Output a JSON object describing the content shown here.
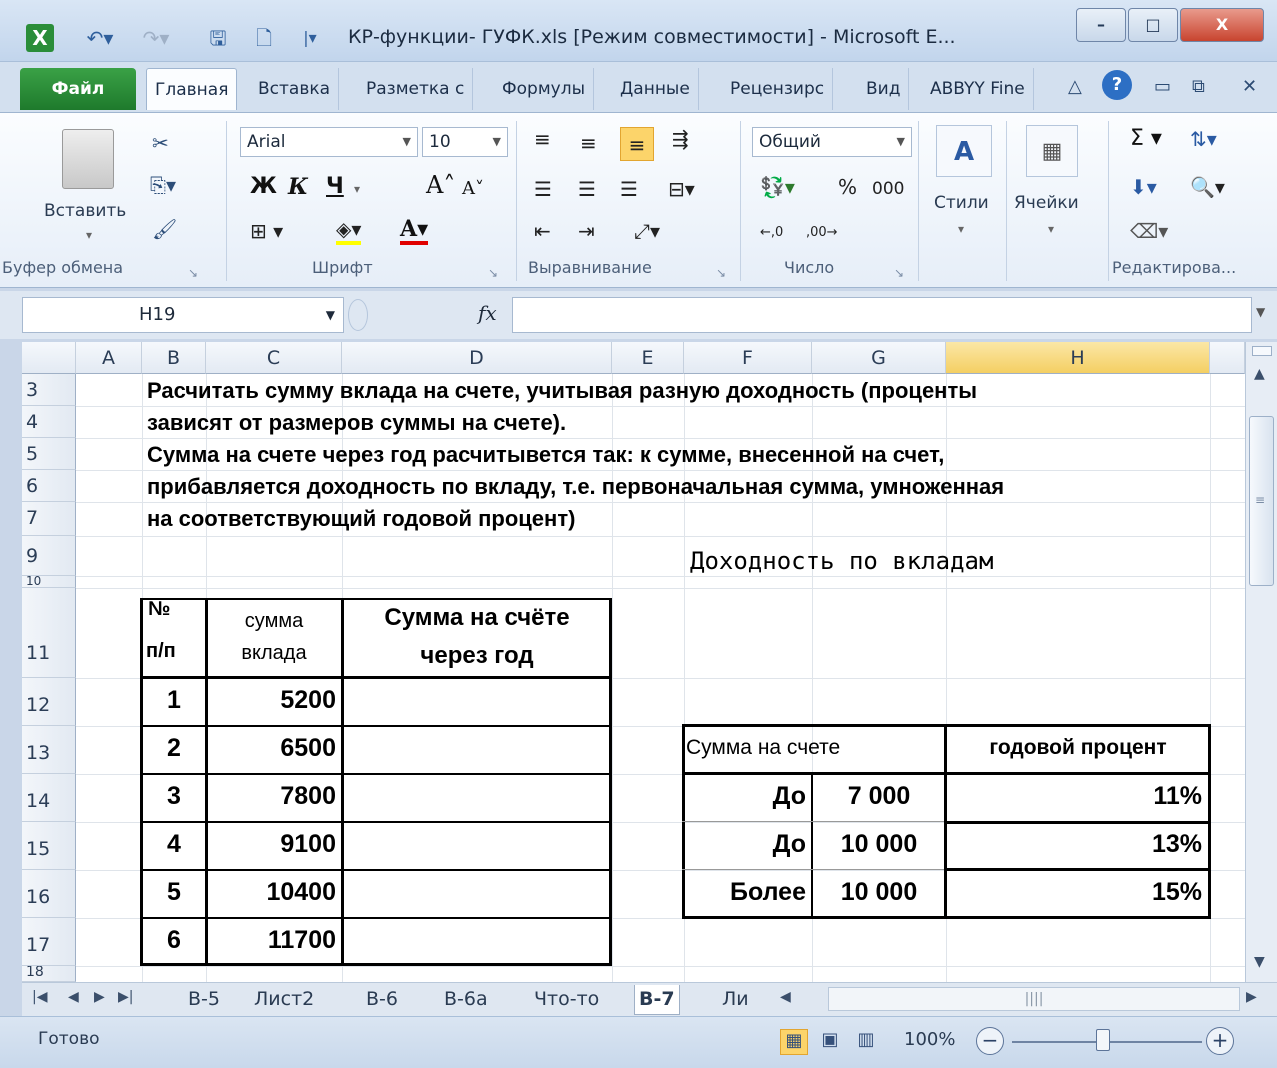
{
  "window": {
    "title": "КР-функции- ГУФК.xls  [Режим совместимости]  -  Microsoft E...",
    "controls": [
      "–",
      "□",
      "X"
    ]
  },
  "ribbon_tabs": [
    "Файл",
    "Главная",
    "Вставка",
    "Разметка с",
    "Формулы",
    "Данные",
    "Рецензирс",
    "Вид",
    "ABBYY Fine"
  ],
  "ribbon": {
    "paste_label": "Вставить",
    "font_name": "Arial",
    "font_size": "10",
    "bold": "Ж",
    "italic": "К",
    "underline": "Ч",
    "number_format": "Общий",
    "percent": "%",
    "thousands": "000",
    "styles_label": "Стили",
    "cells_label": "Ячейки",
    "groups": [
      "Буфер обмена",
      "Шрифт",
      "Выравнивание",
      "Число",
      "Редактирова..."
    ]
  },
  "formula_bar": {
    "cell_ref": "H19",
    "fx": "fx",
    "value": ""
  },
  "columns": [
    "A",
    "B",
    "C",
    "D",
    "E",
    "F",
    "G",
    "H"
  ],
  "rows": [
    "3",
    "4",
    "5",
    "6",
    "7",
    "9",
    "10",
    "11",
    "12",
    "13",
    "14",
    "15",
    "16",
    "17",
    "18"
  ],
  "task_lines": [
    "Расчитать сумму вклада на счете, учитывая разную доходность (проценты",
    "зависят от размеров суммы на счете).",
    "Сумма на счете через год расчитывется так: к сумме, внесенной на счет,",
    "прибавляется доходность по вкладу, т.е. первоначальная сумма, умноженная",
    "на соответствующий годовой процент)"
  ],
  "caption": "Доходность по вкладам",
  "deposits": {
    "headers": {
      "num_1": "№",
      "num_2": "п/п",
      "sum_1": "сумма",
      "sum_2": "вклада",
      "total_1": "Сумма на счёте",
      "total_2": "через год"
    },
    "rows": [
      {
        "n": "1",
        "amount": "5200",
        "total": ""
      },
      {
        "n": "2",
        "amount": "6500",
        "total": ""
      },
      {
        "n": "3",
        "amount": "7800",
        "total": ""
      },
      {
        "n": "4",
        "amount": "9100",
        "total": ""
      },
      {
        "n": "5",
        "amount": "10400",
        "total": ""
      },
      {
        "n": "6",
        "amount": "11700",
        "total": ""
      }
    ]
  },
  "rates": {
    "header_sum": "Сумма на счете",
    "header_rate": "годовой процент",
    "rows": [
      {
        "cond": "До",
        "limit": "7 000",
        "rate": "11%"
      },
      {
        "cond": "До",
        "limit": "10 000",
        "rate": "13%"
      },
      {
        "cond": "Более",
        "limit": "10 000",
        "rate": "15%"
      }
    ]
  },
  "sheet_tabs": [
    "В-5",
    "Лист2",
    "В-6",
    "В-6а",
    "Что-то",
    "В-7",
    "Ли"
  ],
  "active_sheet": "В-7",
  "status": {
    "text": "Готово",
    "zoom": "100%",
    "minus": "−",
    "plus": "+"
  },
  "colors": {
    "selected_header": "#f4cf63",
    "file_tab": "#2a8d39"
  }
}
